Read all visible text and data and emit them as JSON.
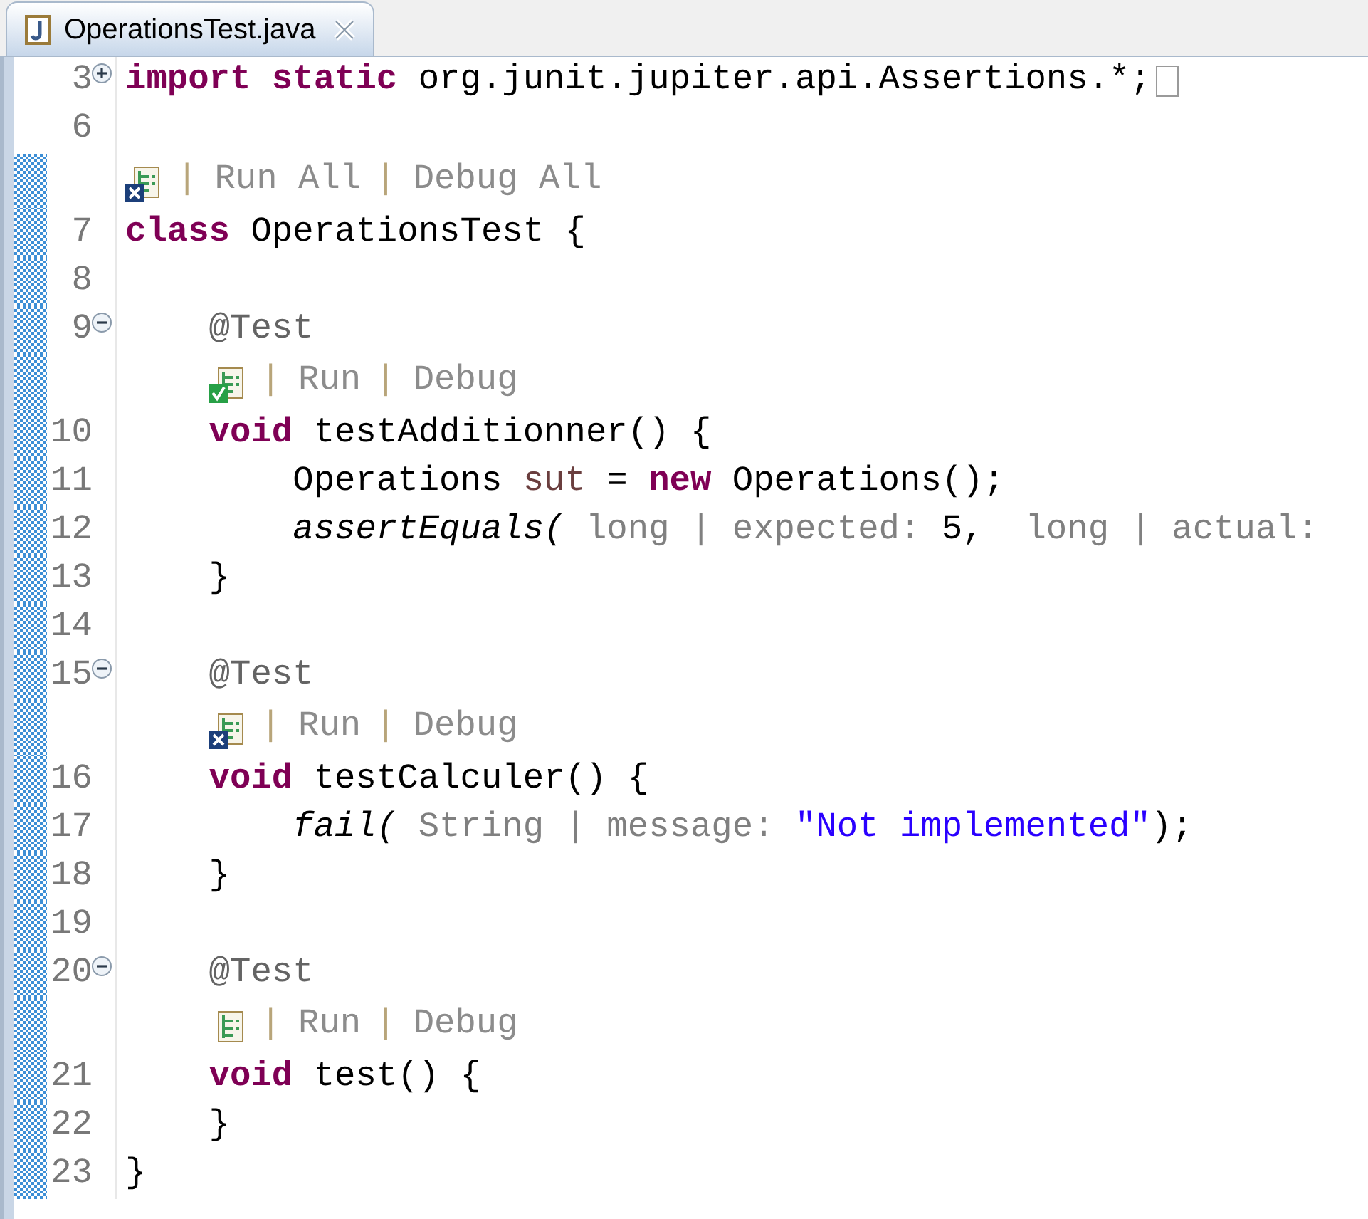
{
  "tab": {
    "title": "OperationsTest.java"
  },
  "lines": [
    {
      "number": "3",
      "fold": {
        "expanded": false
      },
      "marked": false,
      "folded_box": true,
      "tokens": [
        {
          "kind": "kw",
          "t": "import static"
        },
        {
          "kind": "plain",
          "t": " org.junit.jupiter.api.Assertions.*;"
        }
      ]
    },
    {
      "number": "6",
      "marked": false
    },
    {
      "number": "7",
      "marked": true,
      "lens": {
        "kind": "failed",
        "links": [
          {
            "sep": "|",
            "label": "Run All"
          },
          {
            "sep": "|",
            "label": "Debug All"
          }
        ]
      },
      "tokens": [
        {
          "kind": "kw",
          "t": "class"
        },
        {
          "kind": "plain",
          "t": " OperationsTest {"
        }
      ]
    },
    {
      "number": "8",
      "marked": true
    },
    {
      "number": "9",
      "fold": {
        "expanded": true
      },
      "marked": true,
      "tokens": [
        {
          "kind": "annotation",
          "t": "    @Test"
        }
      ]
    },
    {
      "number": "10",
      "marked": true,
      "lens": {
        "kind": "passed",
        "links": [
          {
            "sep": "|",
            "label": "Run"
          },
          {
            "sep": "|",
            "label": "Debug"
          }
        ]
      },
      "tokens": [
        {
          "kind": "kw",
          "t": "    void"
        },
        {
          "kind": "plain",
          "t": " testAdditionner() {"
        }
      ]
    },
    {
      "number": "11",
      "marked": true,
      "tokens": [
        {
          "kind": "plain",
          "t": "        Operations "
        },
        {
          "kind": "local",
          "t": "sut"
        },
        {
          "kind": "plain",
          "t": " = "
        },
        {
          "kind": "kw",
          "t": "new"
        },
        {
          "kind": "plain",
          "t": " Operations();"
        }
      ]
    },
    {
      "number": "12",
      "marked": true,
      "tokens": [
        {
          "kind": "italic",
          "t": "        assertEquals("
        },
        {
          "kind": "hint",
          "t": " long | expected:"
        },
        {
          "kind": "plain",
          "t": " 5,"
        },
        {
          "kind": "hint",
          "t": "  long | actual:"
        }
      ]
    },
    {
      "number": "13",
      "marked": true,
      "tokens": [
        {
          "kind": "plain",
          "t": "    }"
        }
      ]
    },
    {
      "number": "14",
      "marked": true
    },
    {
      "number": "15",
      "fold": {
        "expanded": true
      },
      "marked": true,
      "tokens": [
        {
          "kind": "annotation",
          "t": "    @Test"
        }
      ]
    },
    {
      "number": "16",
      "marked": true,
      "lens": {
        "kind": "failed",
        "links": [
          {
            "sep": "|",
            "label": "Run"
          },
          {
            "sep": "|",
            "label": "Debug"
          }
        ]
      },
      "tokens": [
        {
          "kind": "kw",
          "t": "    void"
        },
        {
          "kind": "plain",
          "t": " testCalculer() {"
        }
      ]
    },
    {
      "number": "17",
      "marked": true,
      "tokens": [
        {
          "kind": "italic",
          "t": "        fail("
        },
        {
          "kind": "hint",
          "t": " String | message:"
        },
        {
          "kind": "string",
          "t": " \"Not implemented\""
        },
        {
          "kind": "plain",
          "t": ");"
        }
      ]
    },
    {
      "number": "18",
      "marked": true,
      "tokens": [
        {
          "kind": "plain",
          "t": "    }"
        }
      ]
    },
    {
      "number": "19",
      "marked": true
    },
    {
      "number": "20",
      "fold": {
        "expanded": true
      },
      "marked": true,
      "tokens": [
        {
          "kind": "annotation",
          "t": "    @Test"
        }
      ]
    },
    {
      "number": "21",
      "marked": true,
      "lens": {
        "kind": "not-run",
        "links": [
          {
            "sep": "|",
            "label": "Run"
          },
          {
            "sep": "|",
            "label": "Debug"
          }
        ]
      },
      "tokens": [
        {
          "kind": "kw",
          "t": "    void"
        },
        {
          "kind": "plain",
          "t": " test() {"
        }
      ]
    },
    {
      "number": "22",
      "marked": true,
      "tokens": [
        {
          "kind": "plain",
          "t": "    }"
        }
      ]
    },
    {
      "number": "23",
      "marked": true,
      "tokens": [
        {
          "kind": "plain",
          "t": "}"
        }
      ]
    }
  ]
}
